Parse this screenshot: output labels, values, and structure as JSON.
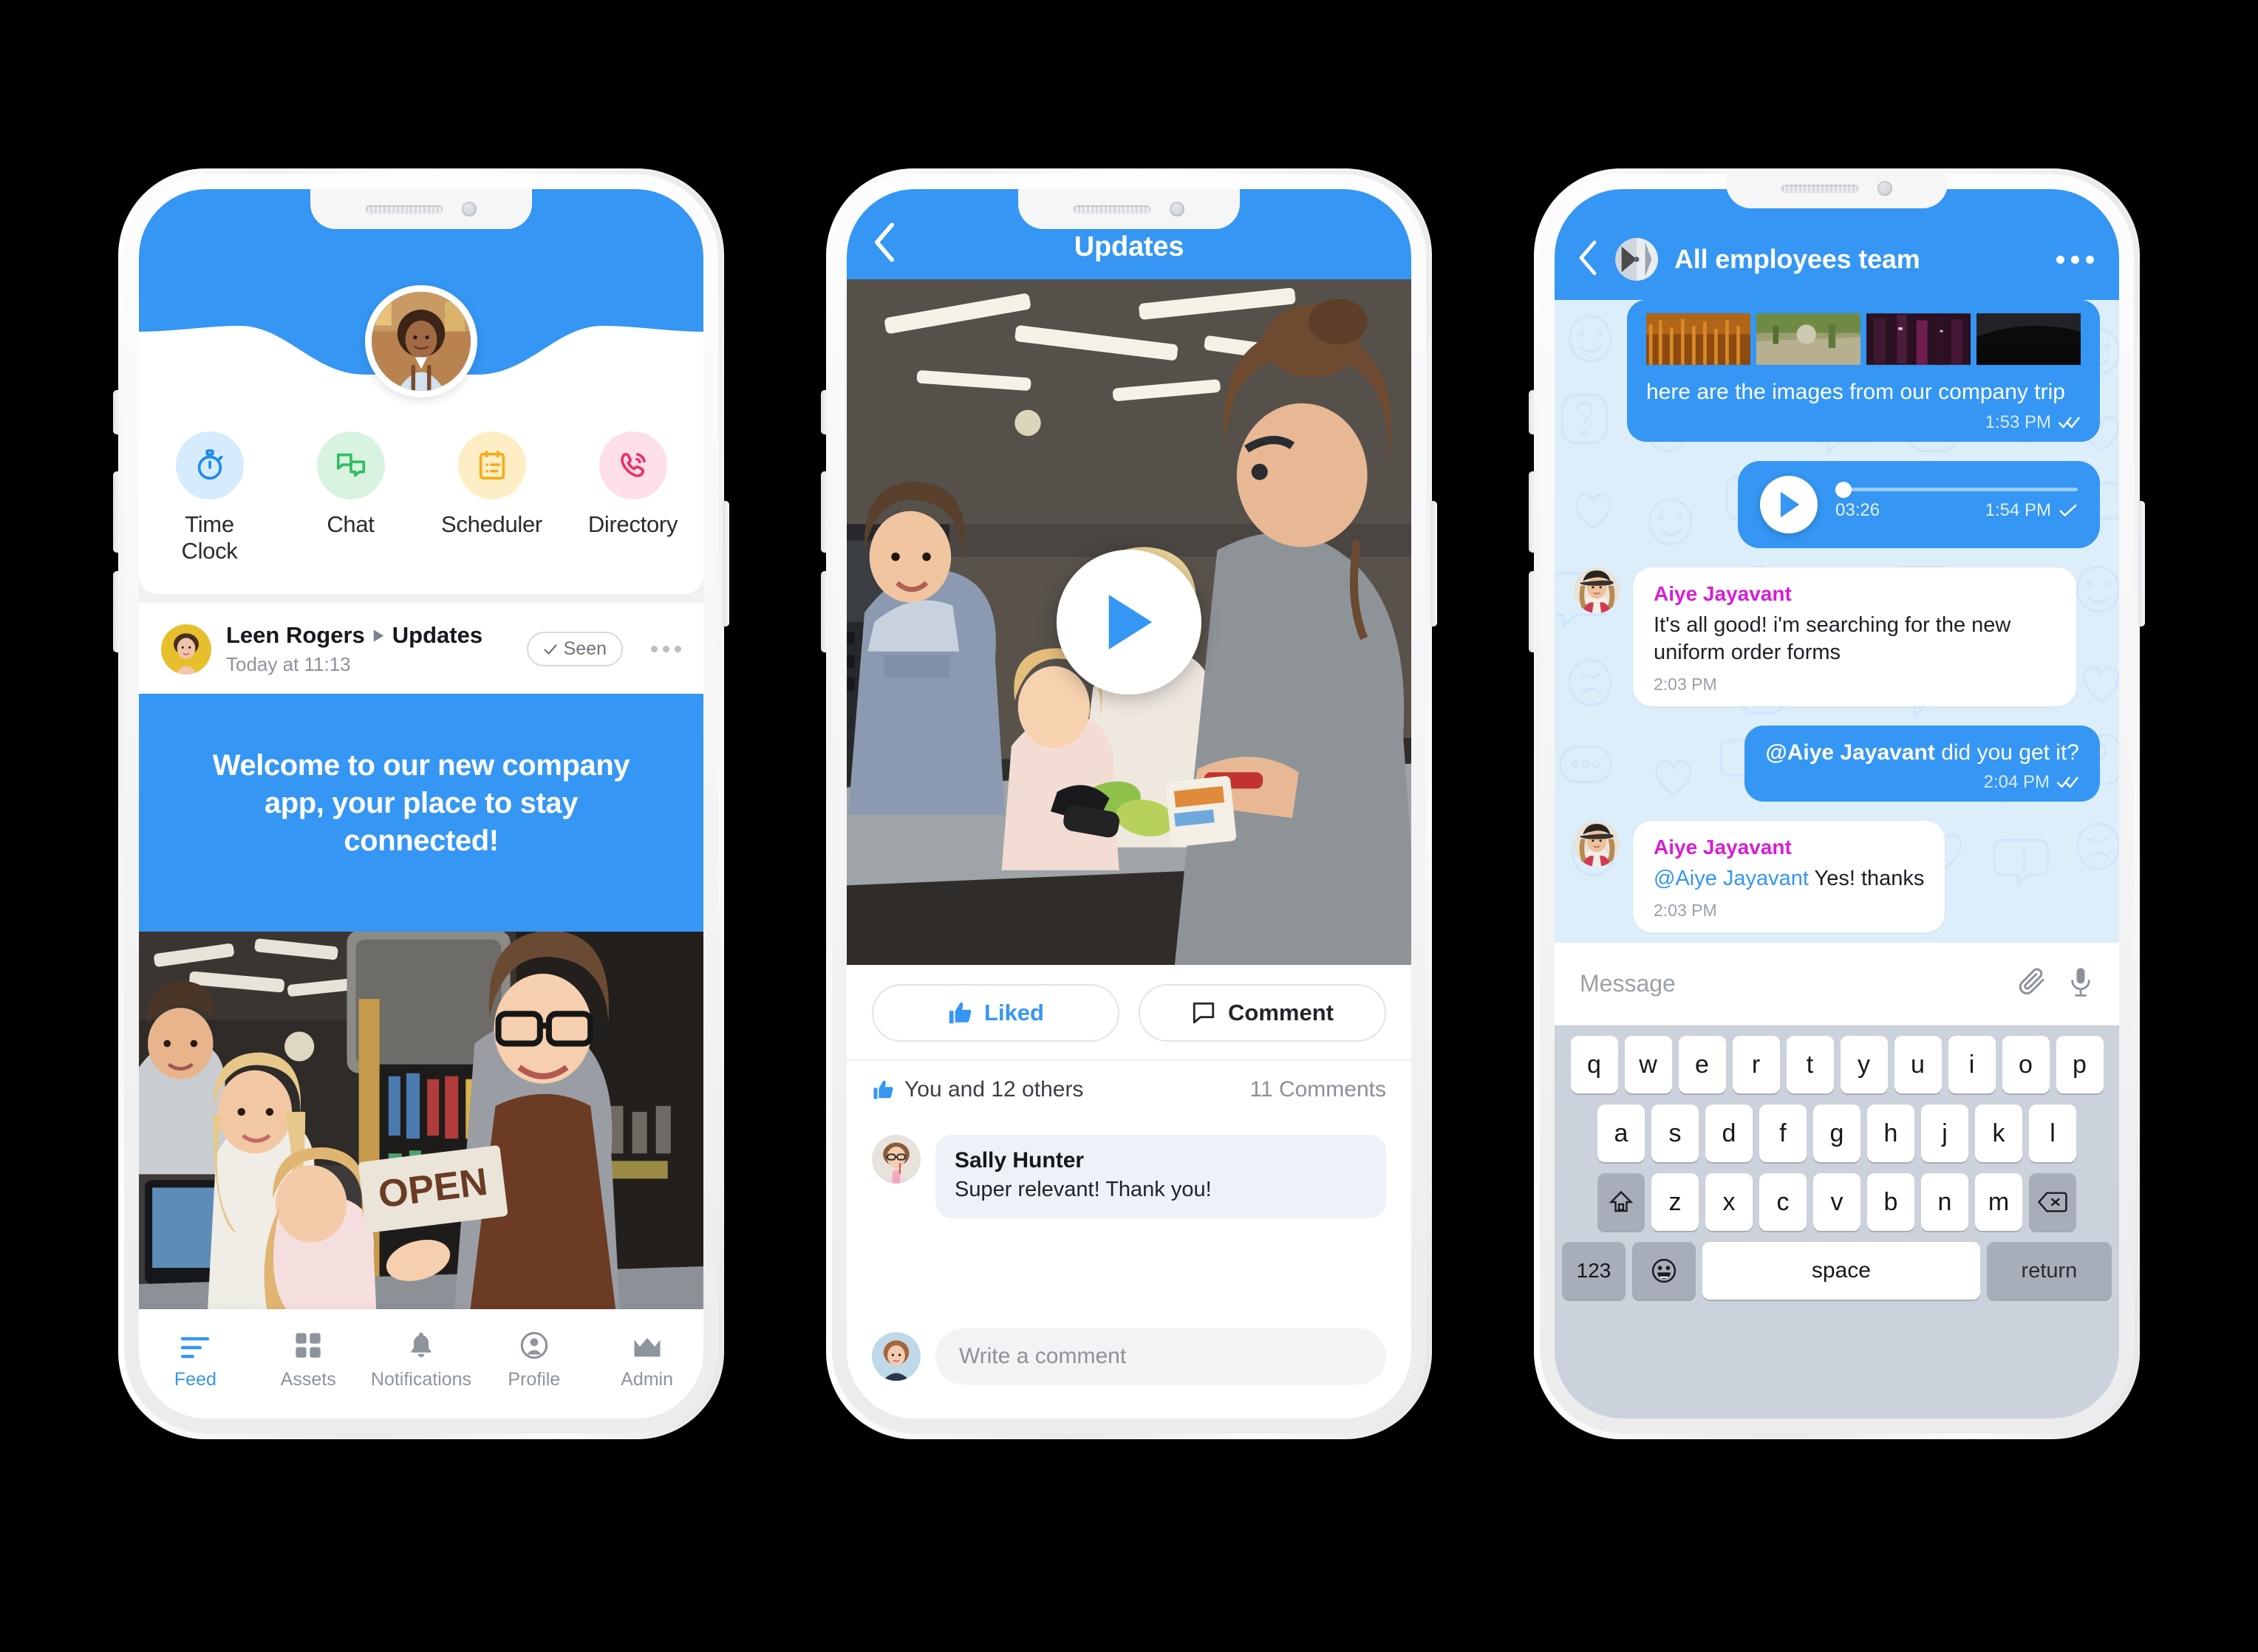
{
  "brand": {
    "accent": "#3596f3",
    "chat_bg": "#ddeefb",
    "mention_name": "#d61ed6"
  },
  "phone1": {
    "quick_actions": [
      {
        "label": "Time Clock",
        "icon": "stopwatch-icon",
        "bg": "#d6ecfd",
        "color": "#1d8bf0"
      },
      {
        "label": "Chat",
        "icon": "chat-bubbles-icon",
        "bg": "#d8f3e0",
        "color": "#31bd62"
      },
      {
        "label": "Scheduler",
        "icon": "clipboard-icon",
        "bg": "#fdeec5",
        "color": "#f5ab1a"
      },
      {
        "label": "Directory",
        "icon": "phone-ring-icon",
        "bg": "#fcdfe8",
        "color": "#ed2e6b"
      }
    ],
    "post": {
      "author": "Leen Rogers",
      "channel": "Updates",
      "time": "Today at 11:13",
      "seen_label": "Seen",
      "banner_text": "Welcome to our new company app, your place to stay connected!"
    },
    "tabs": [
      {
        "label": "Feed",
        "icon": "feed-lines-icon",
        "active": true
      },
      {
        "label": "Assets",
        "icon": "grid-squares-icon",
        "active": false
      },
      {
        "label": "Notifications",
        "icon": "bell-icon",
        "active": false
      },
      {
        "label": "Profile",
        "icon": "person-circle-icon",
        "active": false
      },
      {
        "label": "Admin",
        "icon": "crown-icon",
        "active": false
      }
    ]
  },
  "phone2": {
    "title": "Updates",
    "back_icon": "chevron-left-icon",
    "play_icon": "play-triangle-icon",
    "actions": {
      "like_label": "Liked",
      "comment_label": "Comment"
    },
    "stats": {
      "likes_text": "You and 12 others",
      "comments_text": "11 Comments"
    },
    "comment": {
      "name": "Sally Hunter",
      "text": "Super relevant! Thank you!"
    },
    "composer_placeholder": "Write a comment"
  },
  "phone3": {
    "title": "All employees team",
    "back_icon": "chevron-left-icon",
    "menu_icon": "overflow-dots-icon",
    "messages": [
      {
        "type": "outgoing-images",
        "text": "here are the images from our company trip",
        "time": "1:53 PM",
        "status": "read-double-check"
      },
      {
        "type": "outgoing-voice",
        "duration": "03:26",
        "time": "1:54 PM",
        "status": "sent-single-check"
      },
      {
        "type": "incoming",
        "name": "Aiye Jayavant",
        "text": "It's all good! i'm searching for the new uniform order forms",
        "time": "2:03 PM"
      },
      {
        "type": "outgoing",
        "mention": "@Aiye Jayavant",
        "text": " did you get it?",
        "time": "2:04 PM",
        "status": "read-double-check"
      },
      {
        "type": "incoming",
        "name": "Aiye Jayavant",
        "mention": "@Aiye Jayavant",
        "text": " Yes! thanks",
        "time": "2:03 PM"
      }
    ],
    "input_placeholder": "Message",
    "attach_icon": "paperclip-icon",
    "mic_icon": "microphone-icon",
    "keyboard": {
      "row1": [
        "q",
        "w",
        "e",
        "r",
        "t",
        "y",
        "u",
        "i",
        "o",
        "p"
      ],
      "row2": [
        "a",
        "s",
        "d",
        "f",
        "g",
        "h",
        "j",
        "k",
        "l"
      ],
      "row3_letters": [
        "z",
        "x",
        "c",
        "v",
        "b",
        "n",
        "m"
      ],
      "shift_icon": "shift-home-icon",
      "backspace_icon": "backspace-icon",
      "numbers_label": "123",
      "emoji_icon": "emoji-smile-icon",
      "space_label": "space",
      "return_label": "return"
    }
  }
}
